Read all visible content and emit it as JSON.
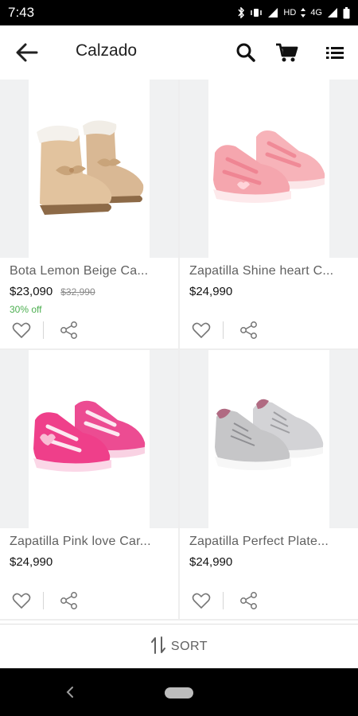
{
  "status_bar": {
    "time": "7:43",
    "network_label": "HD",
    "network_type": "4G",
    "icons": [
      "bluetooth-icon",
      "vibrate-icon",
      "signal-icon",
      "network-arrows-icon",
      "signal-icon",
      "battery-icon"
    ]
  },
  "app_bar": {
    "title": "Calzado",
    "icons": [
      "back-arrow-icon",
      "search-icon",
      "cart-icon",
      "list-view-icon"
    ]
  },
  "products": [
    {
      "name": "Bota Lemon Beige Ca...",
      "price": "$23,090",
      "old_price": "$32,990",
      "discount": "30% off",
      "image": "beige-boot-image",
      "color": "#d9b894"
    },
    {
      "name": "Zapatilla Shine heart C...",
      "price": "$24,990",
      "old_price": "",
      "discount": "",
      "image": "pink-sneaker-image",
      "color": "#f5a6ae"
    },
    {
      "name": "Zapatilla Pink love Car...",
      "price": "$24,990",
      "old_price": "",
      "discount": "",
      "image": "hot-pink-sneaker-image",
      "color": "#ef3f8a"
    },
    {
      "name": "Zapatilla Perfect Plate...",
      "price": "$24,990",
      "old_price": "",
      "discount": "",
      "image": "silver-sneaker-image",
      "color": "#c6c6c8"
    }
  ],
  "sort_bar": {
    "label": "SORT",
    "icon": "sort-arrows-icon"
  },
  "nav_bar": {
    "icons": [
      "nav-back-icon",
      "nav-home-pill-icon"
    ]
  },
  "colors": {
    "discount": "#4caf50",
    "grid_background": "#eeeeee",
    "image_side_background": "#f0f1f2"
  }
}
